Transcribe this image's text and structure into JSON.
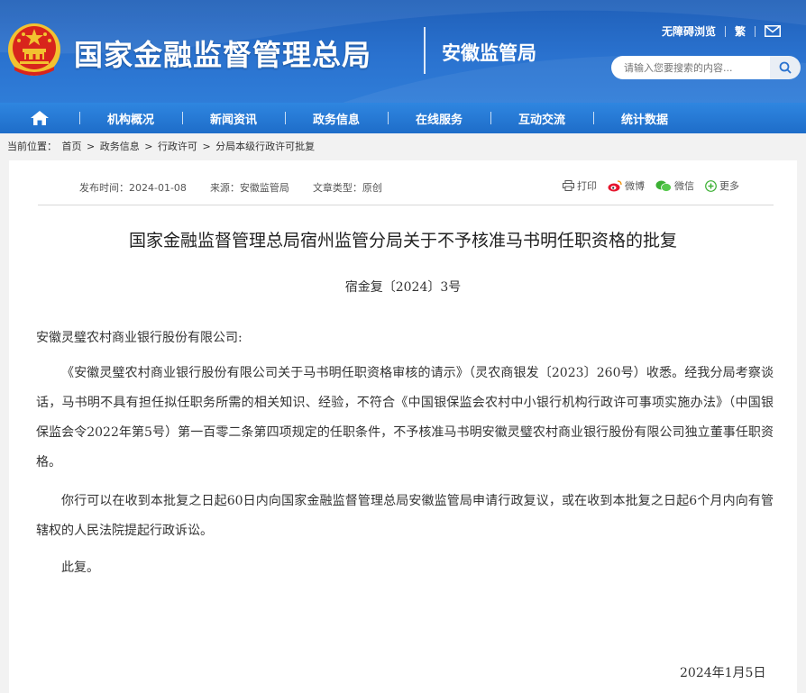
{
  "header": {
    "site_title": "国家金融监督管理总局",
    "sub_title": "安徽监管局",
    "top_links": [
      "无障碍浏览",
      "繁"
    ],
    "search_placeholder": "请输入您要搜索的内容..."
  },
  "nav": {
    "items": [
      "机构概况",
      "新闻资讯",
      "政务信息",
      "在线服务",
      "互动交流",
      "统计数据"
    ]
  },
  "breadcrumb": {
    "label": "当前位置：",
    "items": [
      "首页",
      "政务信息",
      "行政许可",
      "分局本级行政许可批复"
    ],
    "separator": ">"
  },
  "article": {
    "publish_time": "发布时间：2024-01-08",
    "source": "来源：安徽监管局",
    "type": "文章类型：原创",
    "share": [
      "打印",
      "微博",
      "微信",
      "更多"
    ],
    "title": "国家金融监督管理总局宿州监管分局关于不予核准马书明任职资格的批复",
    "doc_number": "宿金复〔2024〕3号",
    "addressee": "安徽灵璧农村商业银行股份有限公司:",
    "paragraphs": [
      "《安徽灵璧农村商业银行股份有限公司关于马书明任职资格审核的请示》（灵农商银发〔2023〕260号）收悉。经我分局考察谈话，马书明不具有担任拟任职务所需的相关知识、经验，不符合《中国银保监会农村中小银行机构行政许可事项实施办法》（中国银保监会令2022年第5号）第一百零二条第四项规定的任职条件，不予核准马书明安徽灵璧农村商业银行股份有限公司独立董事任职资格。",
      "你行可以在收到本批复之日起60日内向国家金融监督管理总局安徽监管局申请行政复议，或在收到本批复之日起6个月内向有管辖权的人民法院提起行政诉讼。",
      "此复。"
    ],
    "sign_date": "2024年1月5日"
  },
  "colors": {
    "header_blue": "#2a72cf",
    "nav_blue": "#1e6dc9",
    "emblem_red": "#d8241c",
    "emblem_gold": "#f2c230"
  }
}
